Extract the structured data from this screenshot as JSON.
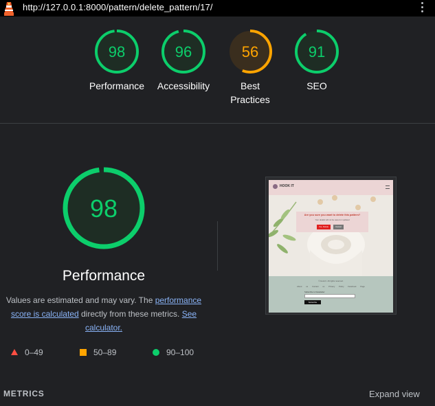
{
  "browser": {
    "url": "http://127.0.0.1:8000/pattern/delete_pattern/17/"
  },
  "colors": {
    "pass": "#0cce6b",
    "average": "#ffa400",
    "fail": "#ff4e42"
  },
  "gauges": [
    {
      "score": "98",
      "label": "Performance",
      "level": 0.98,
      "color": "#0cce6b"
    },
    {
      "score": "96",
      "label": "Accessibility",
      "level": 0.96,
      "color": "#0cce6b"
    },
    {
      "score": "56",
      "label": "Best Practices",
      "level": 0.56,
      "color": "#ffa400"
    },
    {
      "score": "91",
      "label": "SEO",
      "level": 0.91,
      "color": "#0cce6b"
    }
  ],
  "main": {
    "score": "98",
    "level": 0.98,
    "title": "Performance",
    "desc_pre": "Values are estimated and may vary. The ",
    "desc_link1": "performance score is calculated",
    "desc_mid": " directly from these metrics. ",
    "desc_link2": "See calculator.",
    "legend": [
      {
        "icon": "triangle-icon",
        "range": "0–49",
        "color": "#ff4e42"
      },
      {
        "icon": "square-icon",
        "range": "50–89",
        "color": "#ffa400"
      },
      {
        "icon": "circle-icon",
        "range": "90–100",
        "color": "#0cce6b"
      }
    ]
  },
  "thumbnail": {
    "brand": "HOOK IT",
    "question": "Are you sure you want to delete this pattern?",
    "subtext": "Your details will not be saved or updated",
    "yes": "Yes, Delete",
    "cancel": "Cancel",
    "copyright": "© Hook It. All rights reserved.",
    "links": "About us Contact us Privacy Policy Facebook Page",
    "newsletter": "Subscribe to Newsletter",
    "subscribe": "Subscribe"
  },
  "metrics": {
    "label": "METRICS",
    "expand": "Expand view"
  }
}
